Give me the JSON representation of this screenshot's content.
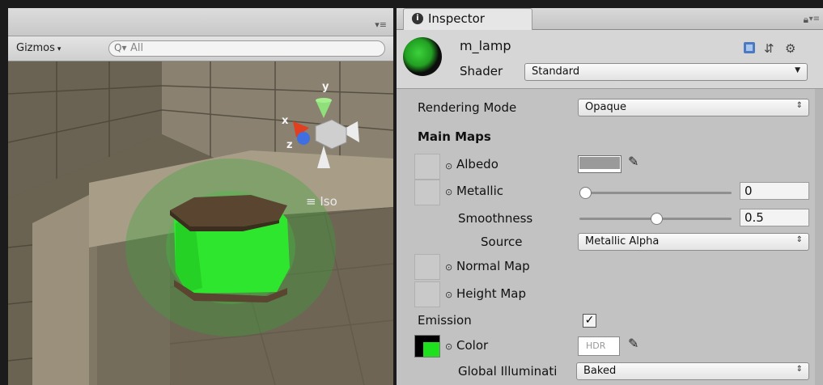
{
  "scene": {
    "gizmos_label": "Gizmos",
    "search_placeholder": "All",
    "view_label": "Iso",
    "axes": {
      "x": "x",
      "y": "y",
      "z": "z"
    }
  },
  "inspector": {
    "tab_title": "Inspector",
    "material_name": "m_lamp",
    "shader_label": "Shader",
    "shader_value": "Standard",
    "rendering_mode_label": "Rendering Mode",
    "rendering_mode_value": "Opaque",
    "main_maps_label": "Main Maps",
    "albedo_label": "Albedo",
    "metallic_label": "Metallic",
    "metallic_value": "0",
    "metallic_fraction": 0,
    "smoothness_label": "Smoothness",
    "smoothness_value": "0.5",
    "smoothness_fraction": 0.5,
    "source_label": "Source",
    "source_value": "Metallic Alpha",
    "normal_map_label": "Normal Map",
    "height_map_label": "Height Map",
    "emission_label": "Emission",
    "emission_checked": true,
    "color_label": "Color",
    "hdr_label": "HDR",
    "gi_label": "Global Illuminati",
    "gi_value": "Baked",
    "emission_color": "#1ee01e",
    "albedo_color": "#9a9a9a"
  }
}
